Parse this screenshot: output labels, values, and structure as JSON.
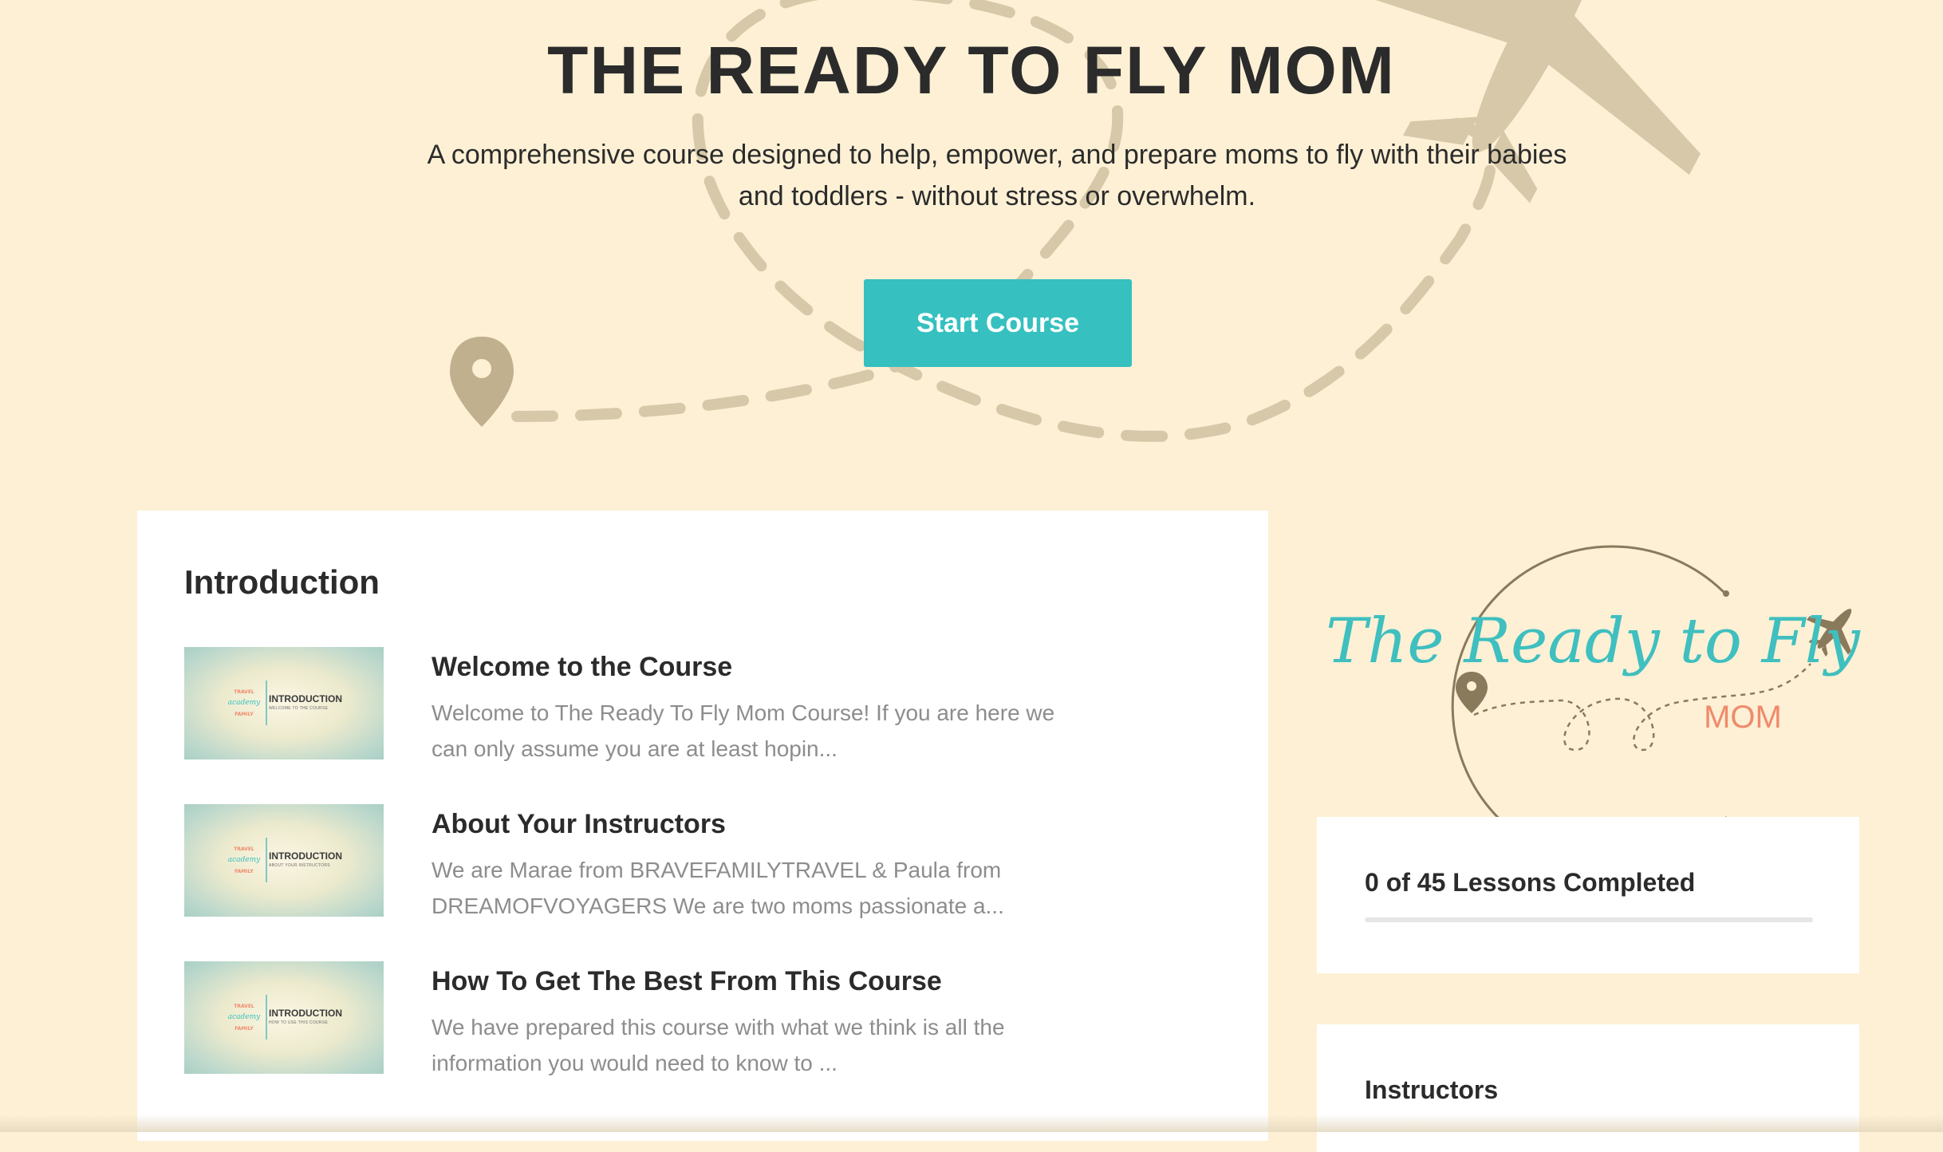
{
  "hero": {
    "title": "THE READY TO FLY MOM",
    "subtitle": "A comprehensive course designed to help, empower, and prepare moms to fly with their babies and toddlers - without stress or overwhelm.",
    "start_button": "Start Course",
    "icons": [
      "map-pin-icon",
      "airplane-icon",
      "dashed-flight-path"
    ]
  },
  "section": {
    "title": "Introduction",
    "lessons": [
      {
        "title": "Welcome to the Course",
        "description": "Welcome to The Ready To Fly Mom Course! If you are here we can only assume you are at least hopin...",
        "thumb_title": "INTRODUCTION",
        "thumb_sub": "WELCOME TO THE COURSE"
      },
      {
        "title": "About Your Instructors",
        "description": "We are Marae from BRAVEFAMILYTRAVEL & Paula from DREAMOFVOYAGERS We are two moms passionate a...",
        "thumb_title": "INTRODUCTION",
        "thumb_sub": "ABOUT YOUR INSTRUCTORS"
      },
      {
        "title": "How To Get The Best From This Course",
        "description": "We have prepared this course with what we think is all the information you would need to know to ...",
        "thumb_title": "INTRODUCTION",
        "thumb_sub": "HOW TO USE THIS COURSE"
      }
    ]
  },
  "thumb_logo": {
    "top": "TRAVEL",
    "middle": "academy",
    "bottom": "FAMILY"
  },
  "brand": {
    "script": "The Ready to Fly",
    "mom": "MOM"
  },
  "progress": {
    "text": "0 of 45 Lessons Completed",
    "completed": 0,
    "total": 45
  },
  "instructors": {
    "title": "Instructors"
  },
  "colors": {
    "background": "#fdf0d5",
    "accent": "#36c0c0",
    "decoration": "#d6c8a8",
    "coral": "#f08a6c"
  }
}
